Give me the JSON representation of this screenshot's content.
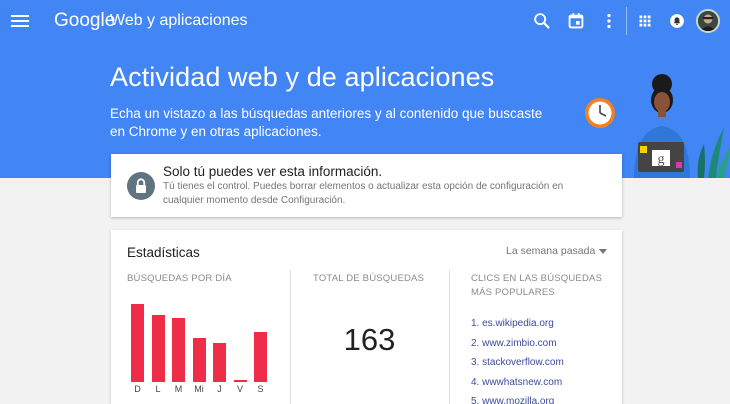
{
  "header": {
    "brand": "Google",
    "app_title": "Web y aplicaciones",
    "icons": [
      "menu-icon",
      "search-icon",
      "calendar-icon",
      "more-vert-icon",
      "apps-icon",
      "notifications-icon",
      "avatar"
    ]
  },
  "hero": {
    "title": "Actividad web y de aplicaciones",
    "description": "Echa un vistazo a las búsquedas anteriores y al contenido que buscaste en Chrome y en otras aplicaciones."
  },
  "privacy": {
    "title": "Solo tú puedes ver esta información.",
    "text": "Tú tienes el control. Puedes borrar elementos o actualizar esta opción de configuración en cualquier momento desde Configuración."
  },
  "stats": {
    "title": "Estadísticas",
    "period": "La semana pasada",
    "searches_per_day_label": "BÚSQUEDAS POR DÍA",
    "total_label": "TOTAL DE BÚSQUEDAS",
    "total_value": "163",
    "clicks_label_line1": "CLICS EN LAS BÚSQUEDAS",
    "clicks_label_line2": "MÁS POPULARES",
    "days": [
      "D",
      "L",
      "M",
      "Mi",
      "J",
      "V",
      "S"
    ],
    "day_values": [
      34,
      29,
      28,
      19,
      17,
      1,
      22
    ],
    "top_sites": [
      "1. es.wikipedia.org",
      "2. www.zimbio.com",
      "3. stackoverflow.com",
      "4. wwwhatsnew.com",
      "5. www.mozilla.org"
    ]
  },
  "colors": {
    "header_blue": "#4285f4",
    "bar_red": "#f02d48",
    "link_blue": "#3c4b9b"
  }
}
